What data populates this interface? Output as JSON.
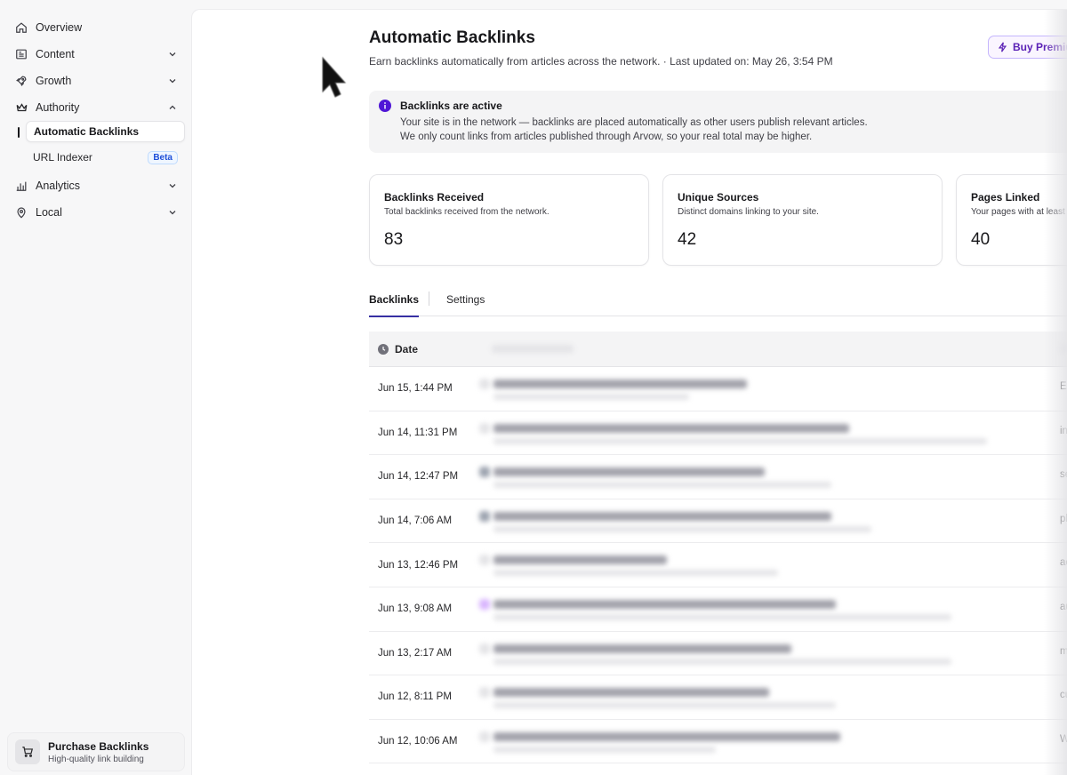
{
  "sidebar": {
    "items": [
      {
        "label": "Overview",
        "icon": "home-icon",
        "chevron": ""
      },
      {
        "label": "Content",
        "icon": "content-icon",
        "chevron": "down"
      },
      {
        "label": "Growth",
        "icon": "rocket-icon",
        "chevron": "down"
      },
      {
        "label": "Authority",
        "icon": "crown-icon",
        "chevron": "up"
      },
      {
        "label": "Analytics",
        "icon": "bar-chart-icon",
        "chevron": "down"
      },
      {
        "label": "Local",
        "icon": "map-pin-icon",
        "chevron": "down"
      }
    ],
    "authority_sub": [
      {
        "label": "Automatic Backlinks",
        "active": true
      },
      {
        "label": "URL Indexer",
        "badge": "Beta"
      }
    ],
    "purchase": {
      "title": "Purchase Backlinks",
      "subtitle": "High-quality link building"
    }
  },
  "header": {
    "title": "Automatic Backlinks",
    "subtitle": "Earn backlinks automatically from articles across the network.  ·  Last updated on: May 26, 3:54 PM",
    "buy_button": "Buy Premium"
  },
  "alert": {
    "title": "Backlinks are active",
    "line1": "Your site is in the network — backlinks are placed automatically as other users publish relevant articles.",
    "line2": "We only count links from articles published through Arvow, so your real total may be higher."
  },
  "stats": [
    {
      "title": "Backlinks Received",
      "desc": "Total backlinks received from the network.",
      "value": "83"
    },
    {
      "title": "Unique Sources",
      "desc": "Distinct domains linking to your site.",
      "value": "42"
    },
    {
      "title": "Pages Linked",
      "desc": "Your pages with at least",
      "value": "40"
    }
  ],
  "tabs": [
    {
      "label": "Backlinks",
      "active": true
    },
    {
      "label": "Settings",
      "active": false
    }
  ],
  "table": {
    "date_header": "Date",
    "rows": [
      {
        "date": "Jun 15, 1:44 PM",
        "edge": "E"
      },
      {
        "date": "Jun 14, 11:31 PM",
        "edge": "in"
      },
      {
        "date": "Jun 14, 12:47 PM",
        "edge": "se"
      },
      {
        "date": "Jun 14, 7:06 AM",
        "edge": "pl"
      },
      {
        "date": "Jun 13, 12:46 PM",
        "edge": "ac"
      },
      {
        "date": "Jun 13, 9:08 AM",
        "edge": "au"
      },
      {
        "date": "Jun 13, 2:17 AM",
        "edge": "m"
      },
      {
        "date": "Jun 12, 8:11 PM",
        "edge": "cu"
      },
      {
        "date": "Jun 12, 10:06 AM",
        "edge": "W"
      }
    ]
  },
  "colors": {
    "accent": "#3730a3",
    "info": "#4f16d6",
    "buy_text": "#5b21b6"
  }
}
